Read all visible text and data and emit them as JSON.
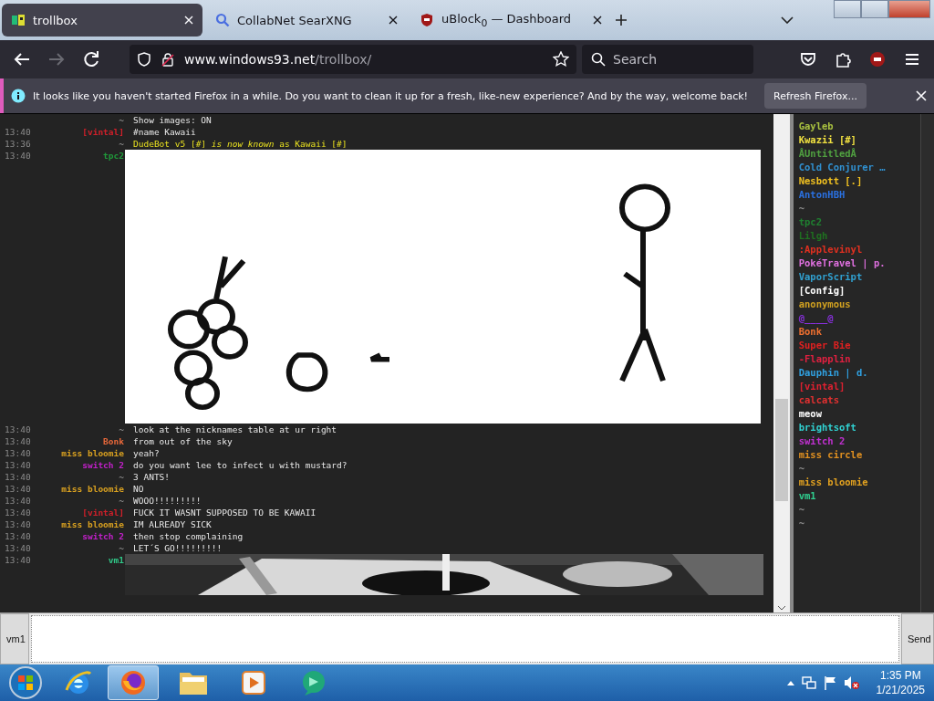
{
  "browser": {
    "tabs": [
      {
        "title": "trollbox",
        "selected": true
      },
      {
        "title": "CollabNet SearXNG",
        "selected": false
      },
      {
        "title": "uBlock$_{0}$ — Dashboard",
        "selected": false
      }
    ],
    "address": {
      "host": "www.windows93.net",
      "path": "/trollbox/"
    },
    "search": {
      "placeholder": "Search"
    }
  },
  "notification": {
    "message": "It looks like you haven't started Firefox in a while. Do you want to clean it up for a fresh, like-new experience? And by the way, welcome back!",
    "button": "Refresh Firefox..."
  },
  "chat": {
    "messages": [
      {
        "kind": "text",
        "nick": "~",
        "text": "Show images: ON"
      },
      {
        "kind": "text",
        "time": "13:40",
        "nick": "[vintal]",
        "color": "#d0202a",
        "text": "#name Kawaii"
      },
      {
        "kind": "system",
        "time": "13:36",
        "nick": "~",
        "text": "DudeBot v5 [#] *is now known* as Kawaii [#]"
      },
      {
        "time": "13:40",
        "nick": "tpc2",
        "color": "#1f9a3a"
      },
      {
        "kind": "text",
        "time": "13:40",
        "nick": "~",
        "text": "look at the nicknames table at ur right"
      },
      {
        "kind": "text",
        "time": "13:40",
        "nick": "Bonk",
        "color": "#e8683a",
        "text": "from out of the sky"
      },
      {
        "kind": "text",
        "time": "13:40",
        "nick": "miss bloomie",
        "color": "#d8a020",
        "text": "yeah?"
      },
      {
        "kind": "text",
        "time": "13:40",
        "nick": "switch 2",
        "color": "#c020c8",
        "text": "do you want lee to infect u with mustard?"
      },
      {
        "kind": "text",
        "time": "13:40",
        "nick": "~",
        "text": "3 ANTS!"
      },
      {
        "kind": "text",
        "time": "13:40",
        "nick": "miss bloomie",
        "color": "#d8a020",
        "text": "NO"
      },
      {
        "kind": "text",
        "time": "13:40",
        "nick": "~",
        "text": "WOOO!!!!!!!!!"
      },
      {
        "kind": "text",
        "time": "13:40",
        "nick": "[vintal]",
        "color": "#d0202a",
        "text": "FUCK IT WASNT SUPPOSED TO BE KAWAII"
      },
      {
        "kind": "text",
        "time": "13:40",
        "nick": "miss bloomie",
        "color": "#d8a020",
        "text": "IM ALREADY SICK"
      },
      {
        "kind": "text",
        "time": "13:40",
        "nick": "switch 2",
        "color": "#c020c8",
        "text": "then stop complaining"
      },
      {
        "kind": "text",
        "time": "13:40",
        "nick": "~",
        "text": "LET´S GO!!!!!!!!!"
      },
      {
        "time": "13:40",
        "nick": "vm1",
        "color": "#30c888"
      }
    ]
  },
  "users": [
    {
      "name": "Gayleb",
      "color": "#a8c040"
    },
    {
      "name": "Kwazii [#]",
      "color": "#f0e040"
    },
    {
      "name": "ÅUntitledÅ",
      "color": "#50a040"
    },
    {
      "name": "Cold Conjurer …",
      "color": "#3090d0"
    },
    {
      "name": "Nesbott [.]",
      "color": "#f0c020"
    },
    {
      "name": "AntonHBH",
      "color": "#2a70e0"
    },
    {
      "name": "~"
    },
    {
      "name": "tpc2",
      "color": "#1f8030"
    },
    {
      "name": "Lilgh",
      "color": "#1f7020"
    },
    {
      "name": ":Applevinyl",
      "color": "#e03020"
    },
    {
      "name": "PokéTravel | p.",
      "color": "#e070e0"
    },
    {
      "name": "VaporScript",
      "color": "#30a0d0"
    },
    {
      "name": "[Config]",
      "color": "#ffffff"
    },
    {
      "name": "anonymous",
      "color": "#d0a020"
    },
    {
      "name": "@____@",
      "color": "#8a30e0"
    },
    {
      "name": "Bonk",
      "color": "#f07030"
    },
    {
      "name": "Super Bie",
      "color": "#e02020"
    },
    {
      "name": "-Flapplin",
      "color": "#e02040"
    },
    {
      "name": "Dauphin | d.",
      "color": "#30a0e0"
    },
    {
      "name": "[vintal]",
      "color": "#e02030"
    },
    {
      "name": "calcats",
      "color": "#e03030"
    },
    {
      "name": "meow",
      "color": "#ffffff"
    },
    {
      "name": "brightsoft",
      "color": "#30d0d0"
    },
    {
      "name": "switch 2",
      "color": "#c030d0"
    },
    {
      "name": "miss circle",
      "color": "#e09020"
    },
    {
      "name": "~"
    },
    {
      "name": "miss bloomie",
      "color": "#e0a020"
    },
    {
      "name": "vm1",
      "color": "#30d090"
    },
    {
      "name": "~"
    },
    {
      "name": "~"
    }
  ],
  "input": {
    "nick": "vm1",
    "send": "Send"
  },
  "taskbar": {
    "apps": [
      {
        "kind": "ie",
        "selected": false
      },
      {
        "kind": "firefox",
        "selected": true
      },
      {
        "kind": "folder",
        "selected": false
      },
      {
        "kind": "media",
        "selected": false
      },
      {
        "kind": "app",
        "selected": false
      }
    ],
    "time": "1:35 PM",
    "date": "1/21/2025"
  }
}
